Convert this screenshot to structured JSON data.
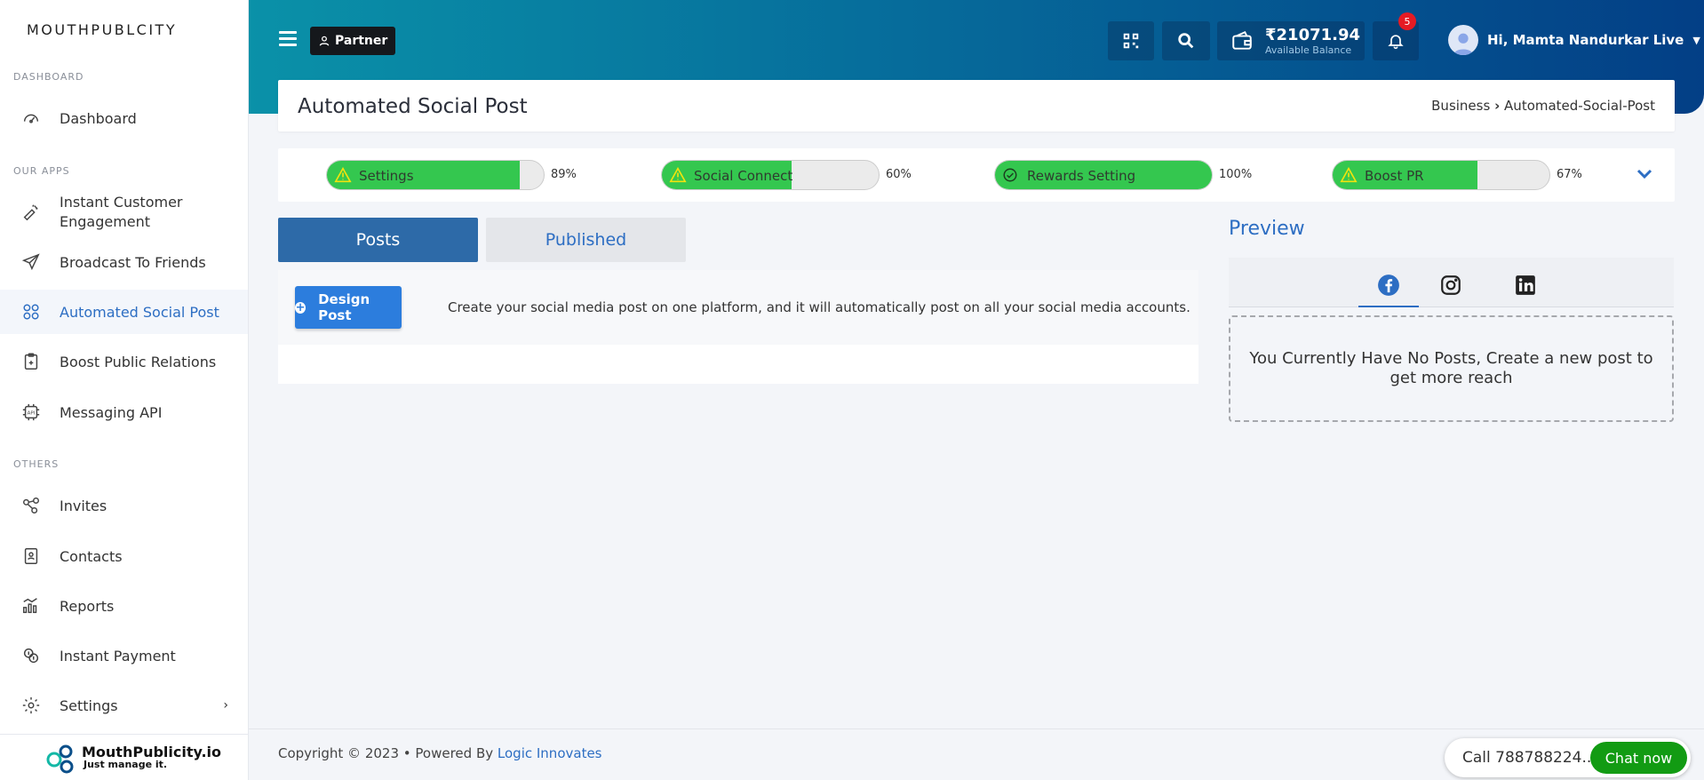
{
  "brand": "MOUTHPUBLCITY",
  "sidebar": {
    "sections": [
      "DASHBOARD",
      "OUR APPS",
      "OTHERS"
    ],
    "items": [
      {
        "label": "Dashboard",
        "icon": "speedometer-icon"
      },
      {
        "label": "Instant Customer Engagement",
        "icon": "megaphone-icon"
      },
      {
        "label": "Broadcast To Friends",
        "icon": "paper-plane-icon"
      },
      {
        "label": "Automated Social Post",
        "icon": "social-network-icon",
        "active": true
      },
      {
        "label": "Boost Public Relations",
        "icon": "clipboard-icon"
      },
      {
        "label": "Messaging API",
        "icon": "api-icon"
      },
      {
        "label": "Invites",
        "icon": "share-icon"
      },
      {
        "label": "Contacts",
        "icon": "contact-book-icon"
      },
      {
        "label": "Reports",
        "icon": "bar-chart-icon"
      },
      {
        "label": "Instant Payment",
        "icon": "payment-icon"
      },
      {
        "label": "Settings",
        "icon": "gear-icon"
      }
    ],
    "footer_logo_title": "MouthPublicity.io",
    "footer_logo_tagline": "Just manage it."
  },
  "topbar": {
    "partner_label": "Partner",
    "balance_amount": "₹21071.94",
    "balance_caption": "Available Balance",
    "notification_count": "5",
    "greeting": "Hi, Mamta Nandurkar Live"
  },
  "page": {
    "title": "Automated Social Post",
    "breadcrumb_root": "Business",
    "breadcrumb_current": "Automated-Social-Post"
  },
  "progress": [
    {
      "label": "Settings",
      "percent": 89,
      "percent_text": "89%",
      "status": "warning"
    },
    {
      "label": "Social Connect",
      "percent": 60,
      "percent_text": "60%",
      "status": "warning"
    },
    {
      "label": "Rewards Setting",
      "percent": 100,
      "percent_text": "100%",
      "status": "complete"
    },
    {
      "label": "Boost PR",
      "percent": 67,
      "percent_text": "67%",
      "status": "warning"
    }
  ],
  "tabs": {
    "posts": "Posts",
    "published": "Published"
  },
  "design": {
    "button_label": "Design Post",
    "description": "Create your social media post on one platform, and it will automatically post on all your social media accounts."
  },
  "preview": {
    "title": "Preview",
    "tabs": [
      "facebook-icon",
      "instagram-icon",
      "linkedin-icon"
    ],
    "empty_message": "You Currently Have No Posts, Create a new post to get more reach"
  },
  "footer": {
    "copyright": "Copyright © 2023",
    "powered_by": "• Powered By",
    "company": "Logic Innovates"
  },
  "call_widget": {
    "number": "Call 788788224...",
    "chat_label": "Chat now"
  },
  "colors": {
    "accent": "#2d6ec3",
    "progress_fill": "#34c74f",
    "chat_green": "#129b13",
    "badge_red": "#e51b24"
  }
}
